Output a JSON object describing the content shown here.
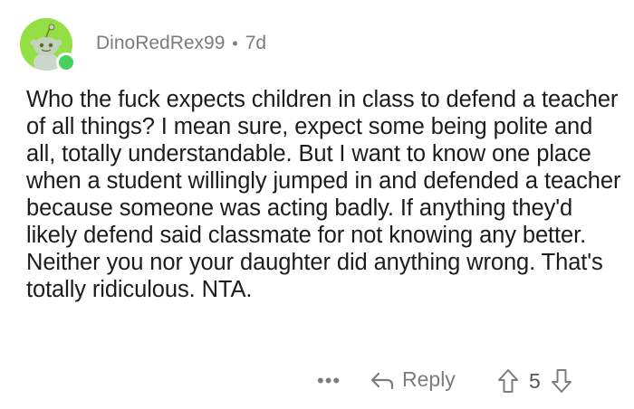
{
  "comment": {
    "username": "DinoRedRex99",
    "separator": "•",
    "age": "7d",
    "body": "Who the fuck expects children in class to defend a teacher of all things? I mean sure, expect some being polite and all, totally understandable. But I want to know one place when a student willingly jumped in and defended a teacher because someone was acting badly. If anything they'd likely defend said classmate for not knowing any better. Neither you nor your daughter did anything wrong. That's totally ridiculous. NTA.",
    "score": "5"
  },
  "actions": {
    "more_label": "•••",
    "reply_label": "Reply"
  },
  "colors": {
    "avatar_bg": "#94e044",
    "online": "#46d160",
    "meta_text": "#7c7c7c"
  },
  "icons": [
    "snoo-avatar-icon",
    "reply-arrow-icon",
    "upvote-icon",
    "downvote-icon",
    "more-icon"
  ]
}
